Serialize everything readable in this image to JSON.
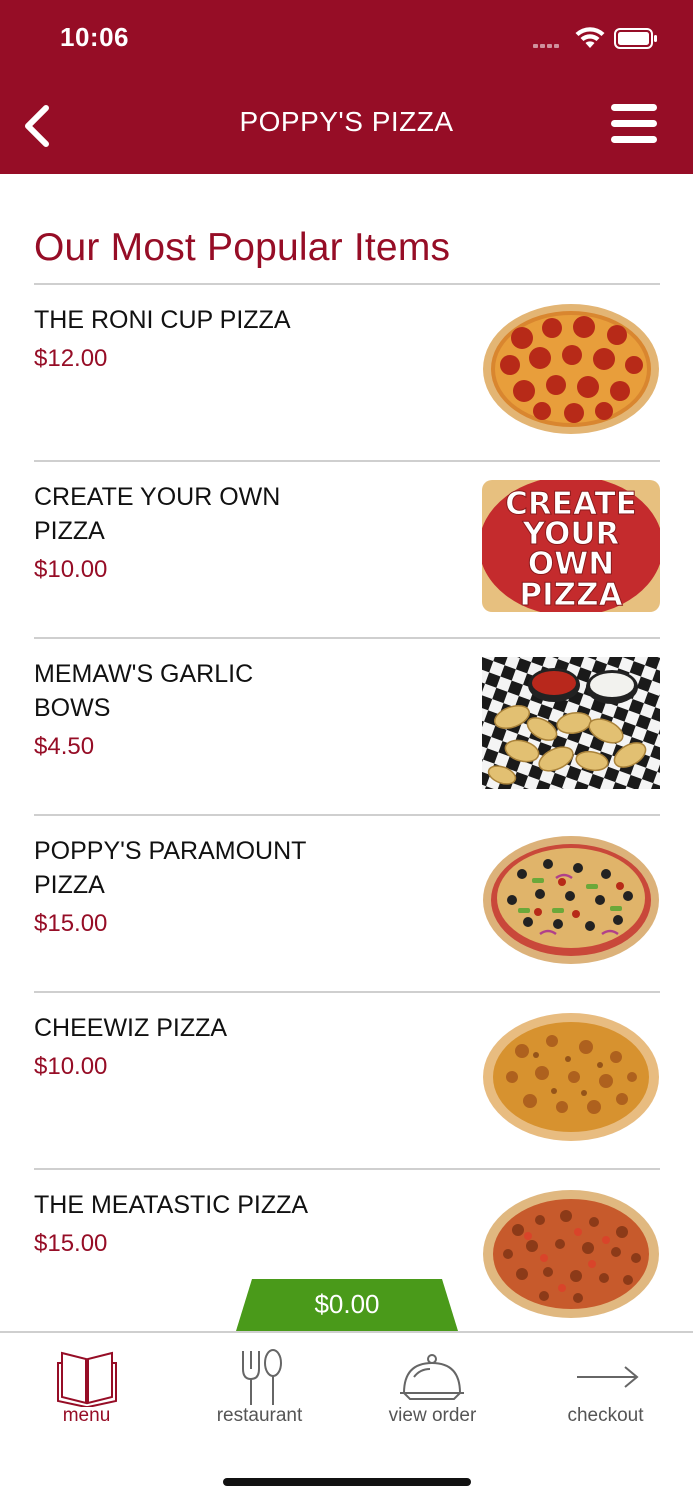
{
  "status_bar": {
    "time": "10:06"
  },
  "header": {
    "title": "POPPY'S PIZZA"
  },
  "section": {
    "title": "Our Most Popular Items"
  },
  "items": [
    {
      "name": "THE RONI CUP PIZZA",
      "price": "$12.00",
      "image": "pepperoni-pizza"
    },
    {
      "name": "CREATE YOUR OWN PIZZA",
      "price": "$10.00",
      "image": "create-your-own-pizza",
      "image_text": "CREATE YOUR OWN PIZZA"
    },
    {
      "name": "MEMAW'S GARLIC BOWS",
      "price": "$4.50",
      "image": "garlic-knots"
    },
    {
      "name": "POPPY'S PARAMOUNT PIZZA",
      "price": "$15.00",
      "image": "supreme-pizza"
    },
    {
      "name": "CHEEWIZ PIZZA",
      "price": "$10.00",
      "image": "cheese-pizza"
    },
    {
      "name": "THE MEATASTIC PIZZA",
      "price": "$15.00",
      "image": "meat-pizza"
    }
  ],
  "cart": {
    "total": "$0.00",
    "color": "#4a9a1a"
  },
  "bottom_nav": [
    {
      "label": "menu",
      "icon": "book-icon",
      "active": true
    },
    {
      "label": "restaurant",
      "icon": "fork-spoon-icon",
      "active": false
    },
    {
      "label": "view order",
      "icon": "cloche-icon",
      "active": false
    },
    {
      "label": "checkout",
      "icon": "arrow-right-icon",
      "active": false
    }
  ],
  "colors": {
    "brand": "#960d26",
    "divider": "#cfcfcf",
    "cart_green": "#4a9a1a"
  }
}
